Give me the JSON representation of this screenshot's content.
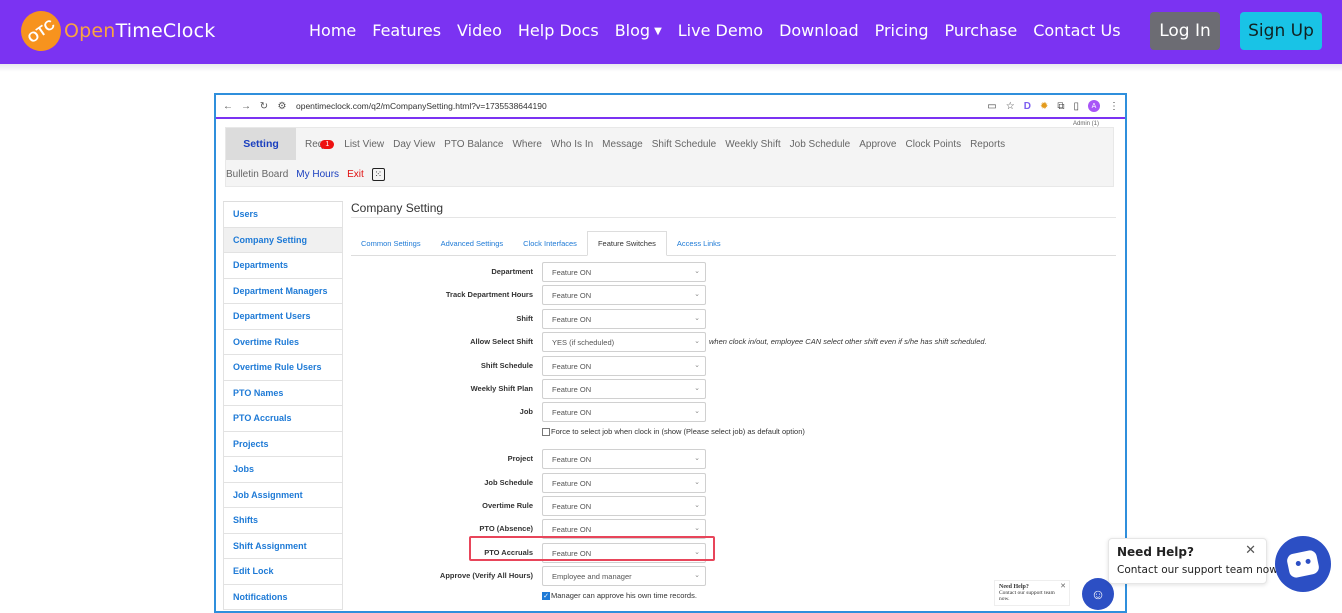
{
  "site": {
    "logo_badge": "OTC",
    "logo_open": "Open",
    "logo_rest": "TimeClock",
    "nav": [
      "Home",
      "Features",
      "Video",
      "Help Docs",
      "Blog",
      "Live Demo",
      "Download",
      "Pricing",
      "Purchase",
      "Contact Us"
    ],
    "login": "Log In",
    "signup": "Sign Up"
  },
  "browser": {
    "url": "opentimeclock.com/q2/mCompanySetting.html?v=1735538644190",
    "account_initial": "A",
    "admin_label": "Admin (1)"
  },
  "app": {
    "active_tab": "Setting",
    "tabs_row1": [
      "Req",
      "List View",
      "Day View",
      "PTO Balance",
      "Where",
      "Who Is In",
      "Message",
      "Shift Schedule",
      "Weekly Shift",
      "Job Schedule",
      "Approve",
      "Clock Points",
      "Reports"
    ],
    "req_badge": "1",
    "tabs_row2": [
      "Bulletin Board",
      "My Hours",
      "Exit"
    ],
    "side_menu": [
      "Users",
      "Company Setting",
      "Departments",
      "Department Managers",
      "Department Users",
      "Overtime Rules",
      "Overtime Rule Users",
      "PTO Names",
      "PTO Accruals",
      "Projects",
      "Jobs",
      "Job Assignment",
      "Shifts",
      "Shift Assignment",
      "Edit Lock",
      "Notifications"
    ],
    "content_title": "Company Setting",
    "sub_tabs": [
      "Common Settings",
      "Advanced Settings",
      "Clock Interfaces",
      "Feature Switches",
      "Access Links"
    ],
    "active_sub_tab": "Feature Switches",
    "settings": [
      {
        "label": "Department",
        "value": "Feature ON"
      },
      {
        "label": "Track Department Hours",
        "value": "Feature ON"
      },
      {
        "label": "Shift",
        "value": "Feature ON"
      },
      {
        "label": "Allow Select Shift",
        "value": "YES (if scheduled)",
        "note": "when clock in/out, employee CAN select other shift even if s/he has shift scheduled."
      },
      {
        "label": "Shift Schedule",
        "value": "Feature ON"
      },
      {
        "label": "Weekly Shift Plan",
        "value": "Feature ON"
      },
      {
        "label": "Job",
        "value": "Feature ON"
      },
      {
        "label": "Project",
        "value": "Feature ON"
      },
      {
        "label": "Job Schedule",
        "value": "Feature ON"
      },
      {
        "label": "Overtime Rule",
        "value": "Feature ON"
      },
      {
        "label": "PTO (Absence)",
        "value": "Feature ON"
      },
      {
        "label": "PTO Accruals",
        "value": "Feature ON"
      },
      {
        "label": "Approve (Verify All Hours)",
        "value": "Employee and manager"
      }
    ],
    "job_checkbox": "Force to select job when clock in (show (Please select job) as default option)",
    "manager_checkbox": "Manager can approve his own time records.",
    "mini_help_title": "Need Help?",
    "mini_help_sub": "Contact our support team now."
  },
  "help_widget": {
    "title": "Need Help?",
    "subtitle": "Contact our support team now."
  },
  "colors": {
    "nav_bg": "#7b33f2",
    "signup_bg": "#19c3e6",
    "login_bg": "#6c6c73",
    "frame_border": "#2f8fdc",
    "highlight": "#e8455a",
    "chatbot": "#2c4fc4"
  }
}
